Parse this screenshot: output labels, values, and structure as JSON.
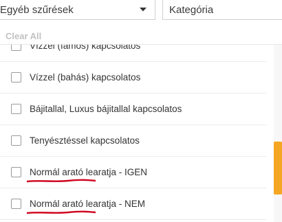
{
  "filters": {
    "other_filters_label": "Egyéb szűrések",
    "category_label": "Kategória"
  },
  "clear_all_label": "Clear All",
  "options": [
    {
      "label": "Vízzel (famos) kapcsolatos",
      "checked": false,
      "highlighted": false
    },
    {
      "label": "Vízzel (bahás) kapcsolatos",
      "checked": false,
      "highlighted": false
    },
    {
      "label": "Bájitallal, Luxus bájitallal kapcsolatos",
      "checked": false,
      "highlighted": false
    },
    {
      "label": "Tenyésztéssel kapcsolatos",
      "checked": false,
      "highlighted": false
    },
    {
      "label": "Normál arató learatja - IGEN",
      "checked": false,
      "highlighted": true
    },
    {
      "label": "Normál arató learatja - NEM",
      "checked": false,
      "highlighted": true
    }
  ],
  "colors": {
    "accent": "#f5a623",
    "annotation": "#d0021b"
  },
  "scroll": {
    "position_fraction": 0.78,
    "visible_fraction": 0.3
  }
}
